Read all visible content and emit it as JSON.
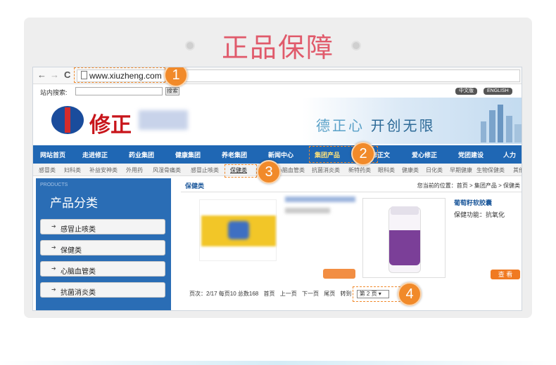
{
  "card_title": "正品保障",
  "browser": {
    "back": "←",
    "forward": "→",
    "reload": "C",
    "url": "www.xiuzheng.com"
  },
  "site": {
    "search_label": "站内搜索:",
    "search_button": "搜索",
    "lang_cn": "中文版",
    "lang_en": "ENGLISH",
    "logo_text": "修正",
    "slogan_a": "德正心",
    "slogan_b": "开创无限",
    "main_nav": [
      "网站首页",
      "走进修正",
      "药业集团",
      "健康集团",
      "养老集团",
      "新闻中心",
      "集团产品",
      "修正文",
      "爱心修正",
      "党团建设",
      "人力"
    ],
    "sub_nav": [
      "感冒类",
      "妇科类",
      "补益安神类",
      "外用药",
      "风湿骨痛类",
      "感冒止咳类",
      "保健类",
      "心脑血管类",
      "抗菌消炎类",
      "新特药类",
      "眼科类",
      "健康类",
      "日化类",
      "早期健康",
      "生物保健类",
      "其他"
    ]
  },
  "sidebar": {
    "en": "PRODUCTS",
    "title": "产品分类",
    "items": [
      "感冒止咳类",
      "保健类",
      "心脑血管类",
      "抗菌消炎类"
    ]
  },
  "content": {
    "section_title": "保健类",
    "breadcrumb": "您当前的位置：首页 > 集团产品 > 保健类",
    "view_button": "查 看",
    "product_name": "葡萄籽软胶囊",
    "product_function": "保健功能：抗氧化"
  },
  "pager": {
    "info": "页次：2/17 每页10 总数168",
    "first": "首页",
    "prev": "上一页",
    "next": "下一页",
    "last": "尾页",
    "goto": "转到",
    "selected": "第 2 页"
  },
  "callouts": [
    "1",
    "2",
    "3",
    "4"
  ],
  "colors": {
    "accent_orange": "#f18a2a",
    "nav_blue": "#1f67b4",
    "title_pink": "#e05a6b"
  }
}
